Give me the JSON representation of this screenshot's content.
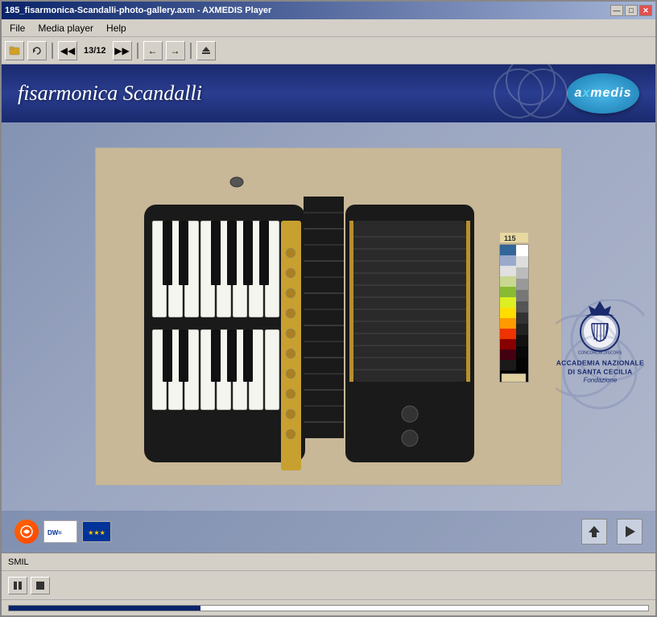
{
  "window": {
    "title": "185_fisarmonica-Scandalli-photo-gallery.axm - AXMEDIS Player",
    "min_btn": "—",
    "max_btn": "□",
    "close_btn": "✕"
  },
  "menu": {
    "file": "File",
    "media_player": "Media player",
    "help": "Help"
  },
  "toolbar": {
    "counter": "13/12",
    "separator": "|"
  },
  "banner": {
    "title": "fisarmonica Scandalli",
    "logo_text": "axmedis"
  },
  "bottom": {
    "upload_btn": "⬆",
    "play_btn": "▶"
  },
  "accademia": {
    "line1": "ACCADEMIA NAZIONALE",
    "line2": "DI SANTA CECILIA",
    "line3": "Fondazione"
  },
  "status": {
    "label": "SMIL"
  },
  "playback": {
    "pause_btn": "⏸",
    "stop_btn": "⏹"
  },
  "color_chart": {
    "label": "115",
    "swatches": [
      "#4466aa",
      "#7788bb",
      "#aabbcc",
      "#ddeecc",
      "#99bb55",
      "#ccdd44",
      "#ffee00",
      "#ff9900",
      "#ee4400",
      "#cc1100",
      "#880022",
      "#330011",
      "#000000"
    ]
  }
}
